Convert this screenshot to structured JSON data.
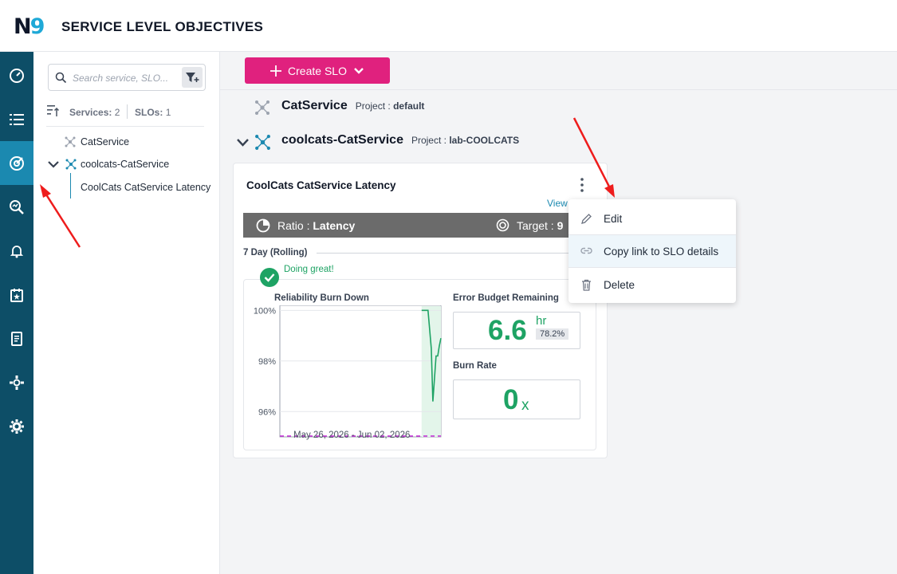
{
  "app": {
    "logo_n": "N",
    "logo_9": "9",
    "title": "SERVICE LEVEL OBJECTIVES"
  },
  "nav": {
    "items": [
      {
        "icon": "dashboard-gauge-icon"
      },
      {
        "icon": "list-icon"
      },
      {
        "icon": "slo-target-icon",
        "active": true
      },
      {
        "icon": "search-analytics-icon"
      },
      {
        "icon": "bell-icon"
      },
      {
        "icon": "calendar-star-icon"
      },
      {
        "icon": "report-icon"
      },
      {
        "icon": "integrations-icon"
      },
      {
        "icon": "gear-icon"
      }
    ]
  },
  "tree": {
    "search_placeholder": "Search service, SLO...",
    "services_label": "Services:",
    "services_count": "2",
    "slos_label": "SLOs:",
    "slos_count": "1",
    "items": [
      {
        "label": "CatService"
      },
      {
        "label": "coolcats-CatService"
      },
      {
        "label": "CoolCats CatService Latency"
      }
    ]
  },
  "main": {
    "create_label": "Create SLO",
    "services": [
      {
        "name": "CatService",
        "project_label": "Project :",
        "project": "default"
      },
      {
        "name": "coolcats-CatService",
        "project_label": "Project :",
        "project": "lab-COOLCATS"
      }
    ],
    "card": {
      "title": "CoolCats CatService Latency",
      "view_link": "View",
      "ratio_label": "Ratio :",
      "ratio_value": "Latency",
      "target_label": "Target :",
      "target_value": "9",
      "window": "7 Day (Rolling)",
      "status": "Doing great!",
      "burn_down_title": "Reliability Burn Down",
      "error_budget_title": "Error Budget Remaining",
      "error_budget_value": "6.6",
      "error_budget_unit": "hr",
      "error_budget_percent": "78.2%",
      "burn_rate_title": "Burn Rate",
      "burn_rate_value": "0",
      "burn_rate_unit": "x",
      "date_range": "May 26, 2026 - Jun 02, 2026"
    }
  },
  "menu": {
    "items": [
      {
        "label": "Edit",
        "icon": "pencil-icon"
      },
      {
        "label": "Copy link to SLO details",
        "icon": "link-icon"
      },
      {
        "label": "Delete",
        "icon": "trash-icon"
      }
    ]
  },
  "colors": {
    "nav_bg": "#0d4e67",
    "nav_active": "#1b89b0",
    "create_btn": "#e0217e",
    "ok_green": "#1ea364",
    "target_line": "#c026d3"
  },
  "chart_data": {
    "type": "line",
    "title": "Reliability Burn Down",
    "xlabel": "May 26, 2026 - Jun 02, 2026",
    "ylabel": "",
    "yticks": [
      "100%",
      "98%",
      "96%"
    ],
    "ylim": [
      95,
      100.2
    ],
    "x": [
      0.0,
      0.88,
      0.89,
      0.92,
      0.94,
      0.95,
      0.96,
      0.97,
      0.98,
      0.99,
      1.0
    ],
    "series": [
      {
        "values": [
          null,
          100.0,
          100.0,
          100.0,
          98.5,
          96.4,
          97.3,
          98.2,
          98.2,
          98.6,
          98.9
        ]
      }
    ],
    "target": 95.0,
    "grid": true
  }
}
